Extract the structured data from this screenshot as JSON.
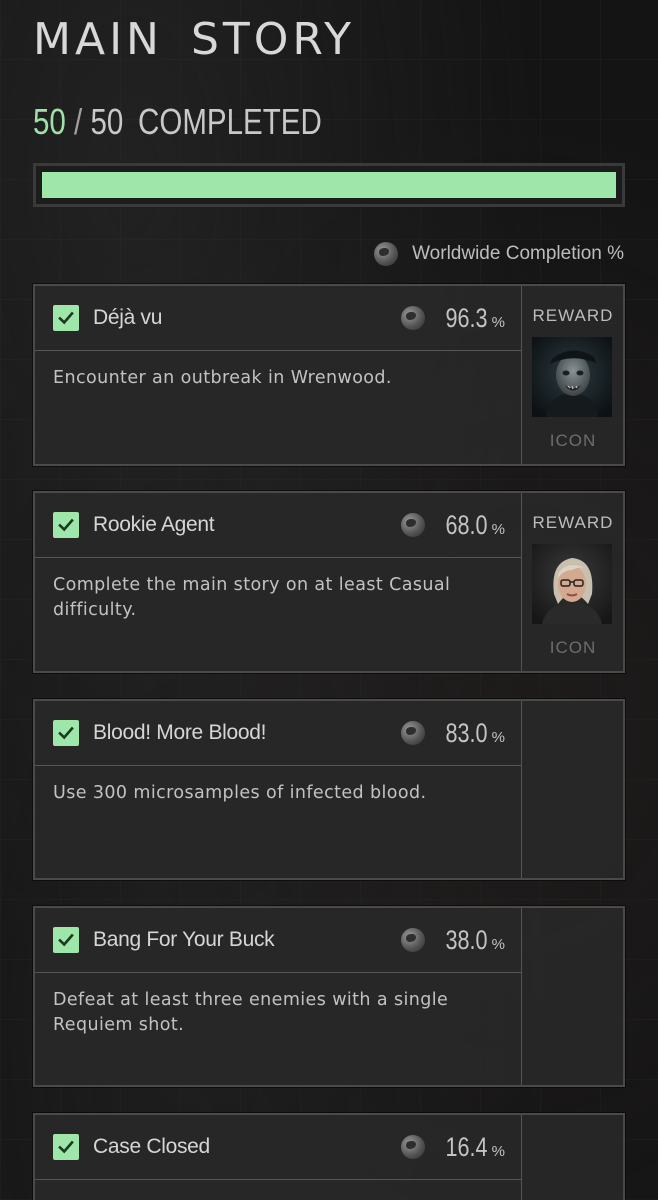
{
  "page": {
    "title": "MAIN STORY"
  },
  "progress": {
    "completed": "50",
    "separator": "/",
    "total": "50",
    "label": "COMPLETED",
    "fraction": 1.0,
    "fill_color": "#9ee6a9"
  },
  "worldwide": {
    "label": "Worldwide Completion %",
    "icon": "globe-icon"
  },
  "achievements": [
    {
      "name": "Déjà vu",
      "percent": "96.3",
      "unit": "%",
      "checked": true,
      "description": "Encounter an outbreak in Wrenwood.",
      "reward": {
        "label": "REWARD",
        "type": "ICON",
        "image": "zombie-portrait"
      }
    },
    {
      "name": "Rookie Agent",
      "percent": "68.0",
      "unit": "%",
      "checked": true,
      "description": "Complete the main story on at least Casual difficulty.",
      "reward": {
        "label": "REWARD",
        "type": "ICON",
        "image": "agent-portrait"
      }
    },
    {
      "name": "Blood! More Blood!",
      "percent": "83.0",
      "unit": "%",
      "checked": true,
      "description": "Use 300 microsamples of infected blood."
    },
    {
      "name": "Bang For Your Buck",
      "percent": "38.0",
      "unit": "%",
      "checked": true,
      "description": "Defeat at least three enemies with a single Requiem shot."
    },
    {
      "name": "Case Closed",
      "percent": "16.4",
      "unit": "%",
      "checked": true
    }
  ],
  "colors": {
    "accent": "#9ee6a9",
    "background": "#141414",
    "card": "#282828"
  }
}
